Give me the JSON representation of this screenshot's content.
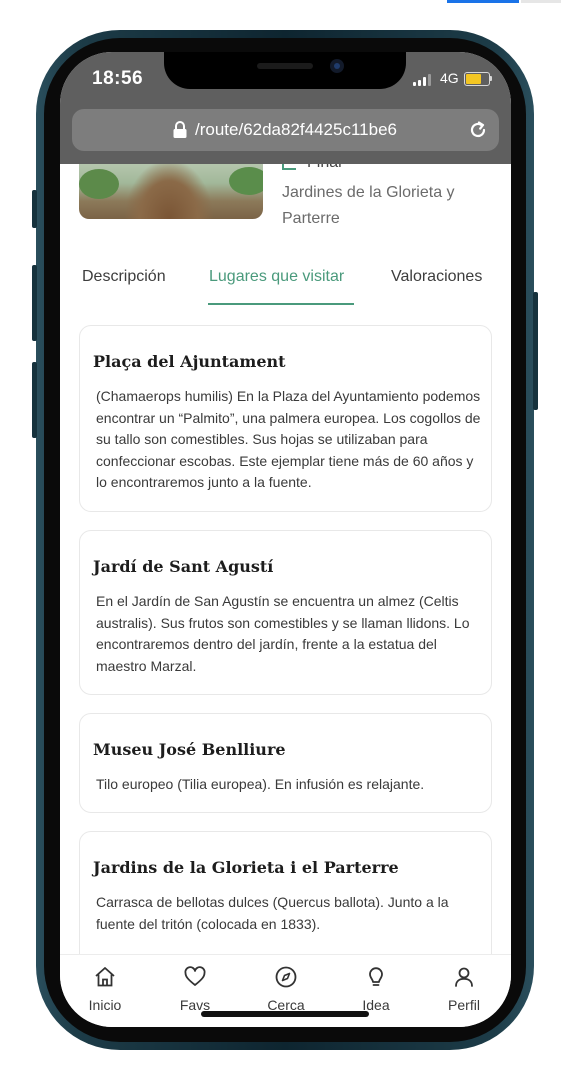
{
  "status_bar": {
    "time": "18:56",
    "network": "4G"
  },
  "browser": {
    "url": "/route/62da82f4425c11be6"
  },
  "route_header": {
    "final_label": "Final",
    "location": "Jardines de la Glorieta y Parterre"
  },
  "tabs": [
    {
      "label": "Descripción",
      "active": false
    },
    {
      "label": "Lugares que visitar",
      "active": true
    },
    {
      "label": "Valoraciones",
      "active": false
    }
  ],
  "places": [
    {
      "title": "Plaça del Ajuntament",
      "description": "(Chamaerops humilis) En la Plaza del Ayuntamiento podemos encontrar un “Palmito”, una palmera europea. Los cogollos de su tallo son comestibles. Sus hojas se utilizaban para confeccionar escobas. Este ejemplar tiene más de 60 años y lo encontraremos junto a la fuente."
    },
    {
      "title": "Jardí de Sant Agustí",
      "description": "En el Jardín de San Agustín se encuentra un almez (Celtis australis). Sus frutos son comestibles y se llaman llidons. Lo encontraremos dentro del jardín, frente a la estatua del maestro Marzal."
    },
    {
      "title": "Museu José Benlliure",
      "description": "Tilo europeo (Tilia europea). En infusión es relajante."
    },
    {
      "title": "Jardins de la Glorieta i el Parterre",
      "description": "Carrasca de bellotas dulces (Quercus ballota). Junto a la fuente del tritón (colocada en 1833)."
    }
  ],
  "bottom_nav": [
    {
      "label": "Inicio",
      "icon": "home-icon"
    },
    {
      "label": "Favs",
      "icon": "heart-icon"
    },
    {
      "label": "Cerca",
      "icon": "compass-icon"
    },
    {
      "label": "Idea",
      "icon": "lightbulb-icon"
    },
    {
      "label": "Perfil",
      "icon": "user-icon"
    }
  ],
  "colors": {
    "accent": "#4a9a7c",
    "status_bar_bg": "#5f5f5f",
    "url_bar_bg": "#7d7d7d"
  }
}
